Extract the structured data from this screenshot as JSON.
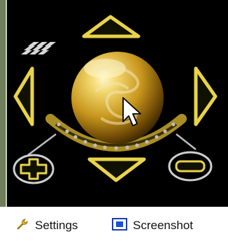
{
  "toolbar": {
    "settings_label": "Settings",
    "screenshot_label": "Screenshot"
  },
  "icons": {
    "settings": "wrench-icon",
    "screenshot": "screenshot-icon",
    "zoom_in": "plus-icon",
    "zoom_out": "minus-icon",
    "grid": "grid-icon",
    "cursor": "mouse-pointer-icon"
  },
  "colors": {
    "accent_gold": "#d9b530",
    "outline_yellow": "#e8d34a",
    "background": "#000000"
  }
}
